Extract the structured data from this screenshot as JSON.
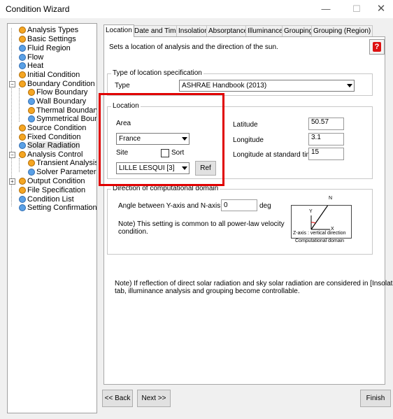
{
  "window": {
    "title": "Condition Wizard",
    "minimize_glyph": "—",
    "maximize_glyph": "☐",
    "close_glyph": "✕"
  },
  "tree": {
    "items": [
      {
        "label": "Analysis Types",
        "icon": "orange-circle-icon"
      },
      {
        "label": "Basic Settings",
        "icon": "orange-circle-icon"
      },
      {
        "label": "Fluid Region",
        "icon": "blue-circle-icon"
      },
      {
        "label": "Flow",
        "icon": "blue-circle-icon"
      },
      {
        "label": "Heat",
        "icon": "blue-circle-icon"
      },
      {
        "label": "Initial Condition",
        "icon": "orange-circle-icon"
      },
      {
        "label": "Boundary Condition",
        "icon": "orange-circle-icon"
      },
      {
        "label": "Flow Boundary",
        "icon": "orange-circle-icon"
      },
      {
        "label": "Wall Boundary",
        "icon": "blue-circle-icon"
      },
      {
        "label": "Thermal Boundary",
        "icon": "orange-circle-icon"
      },
      {
        "label": "Symmetrical Boundar",
        "icon": "blue-circle-icon"
      },
      {
        "label": "Source Condition",
        "icon": "orange-circle-icon"
      },
      {
        "label": "Fixed Condition",
        "icon": "orange-circle-icon"
      },
      {
        "label": "Solar Radiation",
        "icon": "blue-circle-icon"
      },
      {
        "label": "Analysis Control",
        "icon": "orange-circle-icon"
      },
      {
        "label": "Transient Analysis",
        "icon": "orange-circle-icon"
      },
      {
        "label": "Solver Parameters",
        "icon": "blue-circle-icon"
      },
      {
        "label": "Output Condition",
        "icon": "orange-circle-icon"
      },
      {
        "label": "File Specification",
        "icon": "orange-circle-icon"
      },
      {
        "label": "Condition List",
        "icon": "blue-circle-icon"
      },
      {
        "label": "Setting Confirmation",
        "icon": "blue-circle-icon"
      }
    ],
    "collapse_glyph": "−",
    "expand_glyph": "+"
  },
  "tabs": [
    "Location",
    "Date and Time",
    "Insolation",
    "Absorptance",
    "Illuminance",
    "Grouping",
    "Grouping (Region)"
  ],
  "active_tab": "Location",
  "location_tab": {
    "description": "Sets a location of analysis and the direction of the sun.",
    "help_glyph": "?",
    "type_group": {
      "title": "Type of location specification",
      "type_label": "Type",
      "type_value": "ASHRAE Handbook (2013)"
    },
    "location_group": {
      "title": "Location",
      "area_label": "Area",
      "area_value": "France",
      "site_label": "Site",
      "sort_label": "Sort",
      "sort_checked": false,
      "site_value": "LILLE LESQUI [3]",
      "ref_button": "Ref",
      "latitude_label": "Latitude",
      "latitude_value": "50.57",
      "longitude_label": "Longitude",
      "longitude_value": "3.1",
      "longitude_std_label": "Longitude at standard time",
      "longitude_std_value": "15"
    },
    "direction_group": {
      "title": "Direction of computational domain",
      "angle_label": "Angle between Y-axis and N-axis",
      "angle_value": "0",
      "angle_unit": "deg",
      "note_line1": "Note) This setting is common to all power-law velocity",
      "note_line2": "condition.",
      "diagram_n": "N",
      "diagram_y": "Y",
      "diagram_x": "X",
      "diagram_z_caption": "Z-axis : vertical direction",
      "diagram_caption": "Computational domain"
    },
    "bottom_note_line1": "Note) If reflection of direct solar radiation and sky solar radiation are considered in [Insolation]",
    "bottom_note_line2": "tab, illuminance analysis and grouping become controllable."
  },
  "footer": {
    "back": "<< Back",
    "next": "Next >>",
    "finish": "Finish"
  },
  "colors": {
    "highlight_box": "#e00000",
    "tree_icon_orange": "#f5a623",
    "tree_icon_blue": "#5aa0e6"
  }
}
